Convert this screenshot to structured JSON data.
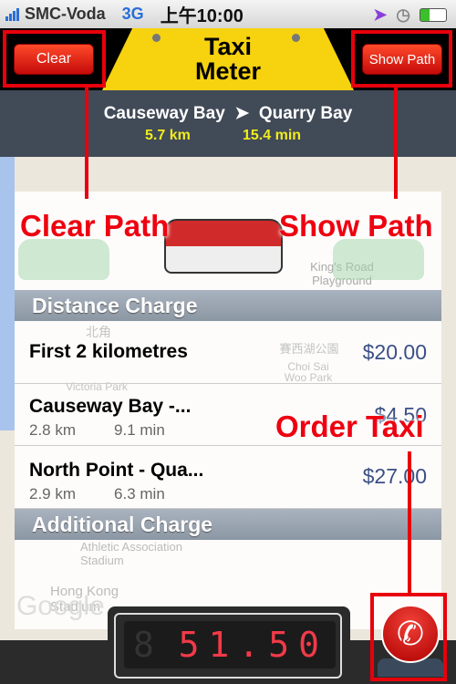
{
  "status_bar": {
    "carrier": "SMC-Voda",
    "network": "3G",
    "time": "上午10:00"
  },
  "header": {
    "title_line1": "Taxi",
    "title_line2": "Meter",
    "clear_label": "Clear",
    "show_path_label": "Show Path"
  },
  "route": {
    "from": "Causeway Bay",
    "arrow": "➤",
    "to": "Quarry Bay",
    "distance": "5.7 km",
    "duration": "15.4 min"
  },
  "annotations": {
    "clear_path": "Clear Path",
    "show_path": "Show Path",
    "order_taxi": "Order Taxi"
  },
  "sections": {
    "distance_charge": "Distance Charge",
    "additional_charge": "Additional Charge"
  },
  "rows": [
    {
      "title": "First 2 kilometres",
      "price": "$20.00"
    },
    {
      "title": "Causeway Bay -...",
      "km": "2.8 km",
      "min": "9.1 min",
      "price": "$4.50"
    },
    {
      "title": "North Point - Qua...",
      "km": "2.9 km",
      "min": "6.3 min",
      "price": "$27.00"
    }
  ],
  "map_labels": [
    "北角",
    "Victoria Park",
    "賽西湖公園",
    "Choi Sai Woo Park",
    "King's Road Playground",
    "Athletic Association Stadium",
    "Hong Kong Stadium",
    "Google"
  ],
  "meter": {
    "fare": "51.50"
  },
  "colors": {
    "accent_red": "#e8000c",
    "sign_yellow": "#f6d20f",
    "price_blue": "#3b4f85",
    "lcd_red": "#f13a48"
  },
  "icons": {
    "order": "phone-icon",
    "location": "location-arrow-icon",
    "clock": "alarm-clock-icon"
  }
}
